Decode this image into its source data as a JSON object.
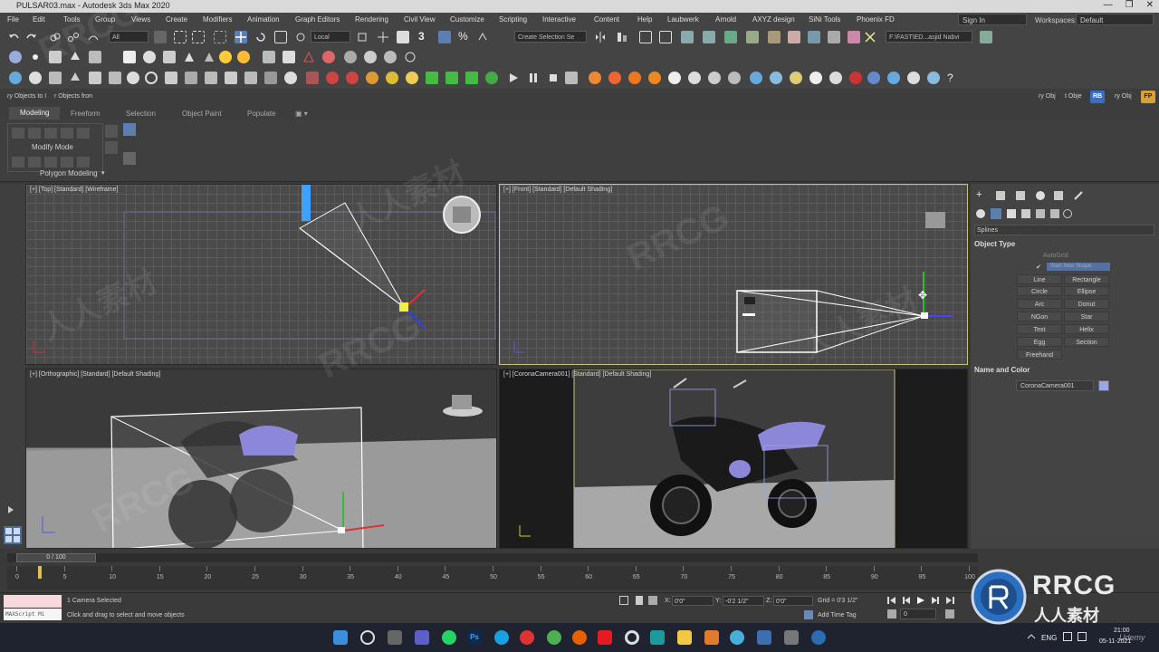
{
  "window": {
    "title": "PULSAR03.max - Autodesk 3ds Max 2020",
    "min": "—",
    "max": "❐",
    "close": "✕"
  },
  "menu": [
    "File",
    "Edit",
    "Tools",
    "Group",
    "Views",
    "Create",
    "Modifiers",
    "Animation",
    "Graph Editors",
    "Rendering",
    "Civil View",
    "Customize",
    "Scripting",
    "Interactive",
    "Content",
    "Help",
    "Laubwerk",
    "Arnold",
    "AXYZ design",
    "SiNi Tools",
    "Phoenix FD"
  ],
  "account": {
    "signin": "Sign In",
    "workspaces_label": "Workspaces:",
    "workspace": "Default"
  },
  "toolbar": {
    "filter": "All",
    "coord": "Local",
    "selection_set": "Create Selection Se",
    "project_path": "F:\\FAST\\ED...asjid Nabvi",
    "snap_three": "3",
    "rb_badge": "RB",
    "fp_badge": "FP"
  },
  "scene_explorer": {
    "left": "ry Objects to I",
    "right": "r Objects fron",
    "yy_obj1": "ry Obj",
    "t_obje": "t Obje",
    "yy_obj2": "ry Obj"
  },
  "ribbon": {
    "tabs": [
      "Modeling",
      "Freeform",
      "Selection",
      "Object Paint",
      "Populate"
    ],
    "active_tab": "Modeling",
    "modify_mode": "Modify Mode",
    "polygon_modeling": "Polygon Modeling"
  },
  "viewports": {
    "top": "[+] [Top] [Standard] [Wireframe]",
    "front": "[+] [Front] [Standard] [Default Shading]",
    "ortho": "[+] [Orthographic] [Standard] [Default Shading]",
    "camera": "[+] [CoronaCamera001] [Standard] [Default Shading]"
  },
  "command_panel": {
    "category": "Splines",
    "object_type_header": "Object Type",
    "autogrid": "AutoGrid",
    "start_new_shape": "Start New Shape",
    "buttons": [
      "Line",
      "Rectangle",
      "Circle",
      "Ellipse",
      "Arc",
      "Donut",
      "NGon",
      "Star",
      "Text",
      "Helix",
      "Egg",
      "Section",
      "Freehand"
    ],
    "name_color_header": "Name and Color",
    "object_name": "CoronaCamera001",
    "object_color": "#9aa6e8"
  },
  "timeline": {
    "frame_display": "0 / 100",
    "ticks": [
      "0",
      "5",
      "10",
      "15",
      "20",
      "25",
      "30",
      "35",
      "40",
      "45",
      "50",
      "55",
      "60",
      "65",
      "70",
      "75",
      "80",
      "85",
      "90",
      "95",
      "100"
    ]
  },
  "status": {
    "maxscript": "MAXScript Mi",
    "line1": "1 Camera Selected",
    "line2": "Click and drag to select and move objects",
    "x_label": "X:",
    "x_value": "0'0\"",
    "y_label": "Y:",
    "y_value": "-0'2 1/2\"",
    "z_label": "Z:",
    "z_value": "0'0\"",
    "grid": "Grid = 0'3 1/2\"",
    "add_time_tag": "Add Time Tag",
    "frame_field": "0"
  },
  "taskbar": {
    "lang": "ENG",
    "time": "21:00",
    "date": "05-11-2021"
  },
  "watermarks": [
    "RRCG",
    "人人素材",
    "RRCG",
    "人人素材",
    "RRCG",
    "人人素材",
    "RRCG"
  ],
  "brand": {
    "rrcg": "RRCG",
    "cn": "人人素材",
    "udemy": "Udemy"
  }
}
